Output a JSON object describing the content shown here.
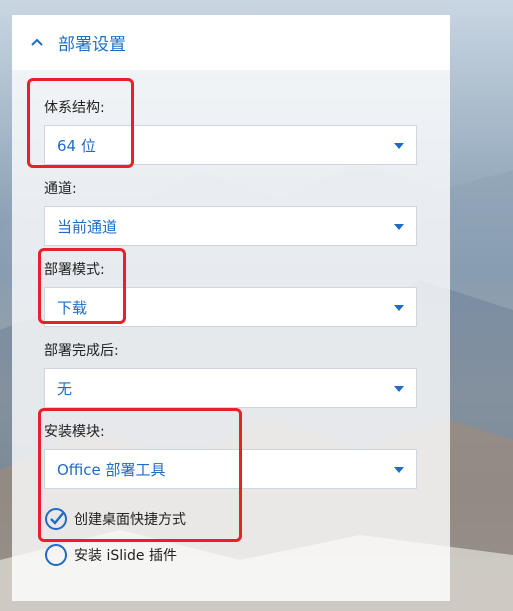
{
  "panel": {
    "title": "部署设置",
    "fields": [
      {
        "label": "体系结构:",
        "value": "64 位"
      },
      {
        "label": "通道:",
        "value": "当前通道"
      },
      {
        "label": "部署模式:",
        "value": "下载"
      },
      {
        "label": "部署完成后:",
        "value": "无"
      },
      {
        "label": "安装模块:",
        "value": "Office 部署工具"
      }
    ],
    "options": [
      {
        "label": "创建桌面快捷方式",
        "checked": true
      },
      {
        "label": "安装 iSlide 插件",
        "checked": false
      }
    ]
  },
  "colors": {
    "accent": "#1f6cc4",
    "highlight": "#e8202a"
  }
}
